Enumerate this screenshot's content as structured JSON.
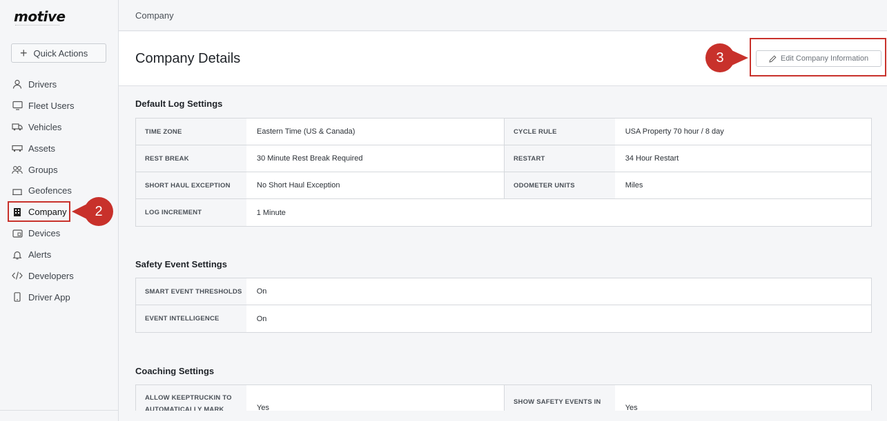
{
  "brand": {
    "logo": "motive"
  },
  "sidebar": {
    "quick_actions": "Quick Actions",
    "items": [
      {
        "label": "Drivers",
        "icon": "person-icon"
      },
      {
        "label": "Fleet Users",
        "icon": "monitor-icon"
      },
      {
        "label": "Vehicles",
        "icon": "truck-icon"
      },
      {
        "label": "Assets",
        "icon": "trailer-icon"
      },
      {
        "label": "Groups",
        "icon": "group-icon"
      },
      {
        "label": "Geofences",
        "icon": "geofence-icon"
      },
      {
        "label": "Company",
        "icon": "building-icon"
      },
      {
        "label": "Devices",
        "icon": "device-icon"
      },
      {
        "label": "Alerts",
        "icon": "bell-icon"
      },
      {
        "label": "Developers",
        "icon": "code-icon"
      },
      {
        "label": "Driver App",
        "icon": "phone-icon"
      }
    ]
  },
  "callouts": {
    "company": "2",
    "edit": "3"
  },
  "breadcrumb": "Company",
  "page_title": "Company Details",
  "edit_button": "Edit Company Information",
  "sections": {
    "log": {
      "title": "Default Log Settings",
      "rows": [
        {
          "k1": "TIME ZONE",
          "v1": "Eastern Time (US & Canada)",
          "k2": "CYCLE RULE",
          "v2": "USA Property 70 hour / 8 day"
        },
        {
          "k1": "REST BREAK",
          "v1": "30 Minute Rest Break Required",
          "k2": "RESTART",
          "v2": "34 Hour Restart"
        },
        {
          "k1": "SHORT HAUL EXCEPTION",
          "v1": "No Short Haul Exception",
          "k2": "ODOMETER UNITS",
          "v2": "Miles"
        },
        {
          "k1": "LOG INCREMENT",
          "v1": "1 Minute"
        }
      ]
    },
    "safety": {
      "title": "Safety Event Settings",
      "rows": [
        {
          "k1": "SMART EVENT THRESHOLDS",
          "v1": "On"
        },
        {
          "k1": "EVENT INTELLIGENCE",
          "v1": "On"
        }
      ]
    },
    "coaching": {
      "title": "Coaching Settings",
      "rows": [
        {
          "k1": "ALLOW KEEPTRUCKIN TO AUTOMATICALLY MARK",
          "v1": "Yes",
          "k2": "SHOW SAFETY EVENTS IN",
          "v2": "Yes"
        }
      ]
    }
  },
  "colors": {
    "accent_red": "#c8312b",
    "sidebar_bg": "#f5f6f8"
  }
}
